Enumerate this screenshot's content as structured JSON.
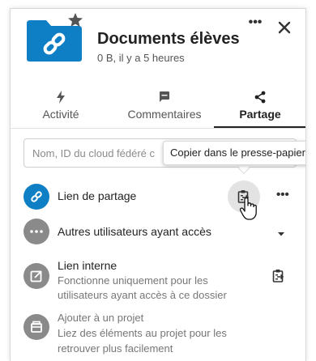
{
  "header": {
    "title": "Documents élèves",
    "subtitle": "0 B, il y a 5 heures",
    "folder_color": "#0e7fc5",
    "folder_icon": "link-folder-icon",
    "favorite_icon": "star-icon",
    "more_label": "•••",
    "close_icon": "close-icon"
  },
  "tabs": [
    {
      "label": "Activité",
      "icon": "lightning-icon"
    },
    {
      "label": "Commentaires",
      "icon": "comment-icon"
    },
    {
      "label": "Partage",
      "icon": "share-icon",
      "active": true
    }
  ],
  "search": {
    "placeholder": "Nom, ID du cloud fédéré ou adresse e-mail…",
    "value": "Nom, ID du cloud fédéré c"
  },
  "tooltip": {
    "text": "Copier dans le presse-papier"
  },
  "share_link": {
    "label": "Lien de partage",
    "avatar_color": "#0e7fc5",
    "icon": "link-icon",
    "copy_icon": "clipboard-icon",
    "more_label": "•••"
  },
  "other_users": {
    "label": "Autres utilisateurs ayant accès",
    "avatar_color": "#8a8a8a",
    "icon": "more-horizontal-icon"
  },
  "internal_link": {
    "label": "Lien interne",
    "description_line1": "Fonctionne uniquement pour les",
    "description_line2": "utilisateurs ayant accès à ce dossier",
    "avatar_color": "#8a8a8a",
    "icon": "external-link-icon",
    "copy_icon": "clipboard-icon"
  },
  "project": {
    "label": "Ajouter à un projet",
    "description_line1": "Liez des éléments au projet pour les",
    "description_line2": "retrouver plus facilement",
    "avatar_color": "#8a8a8a",
    "icon": "project-icon"
  }
}
